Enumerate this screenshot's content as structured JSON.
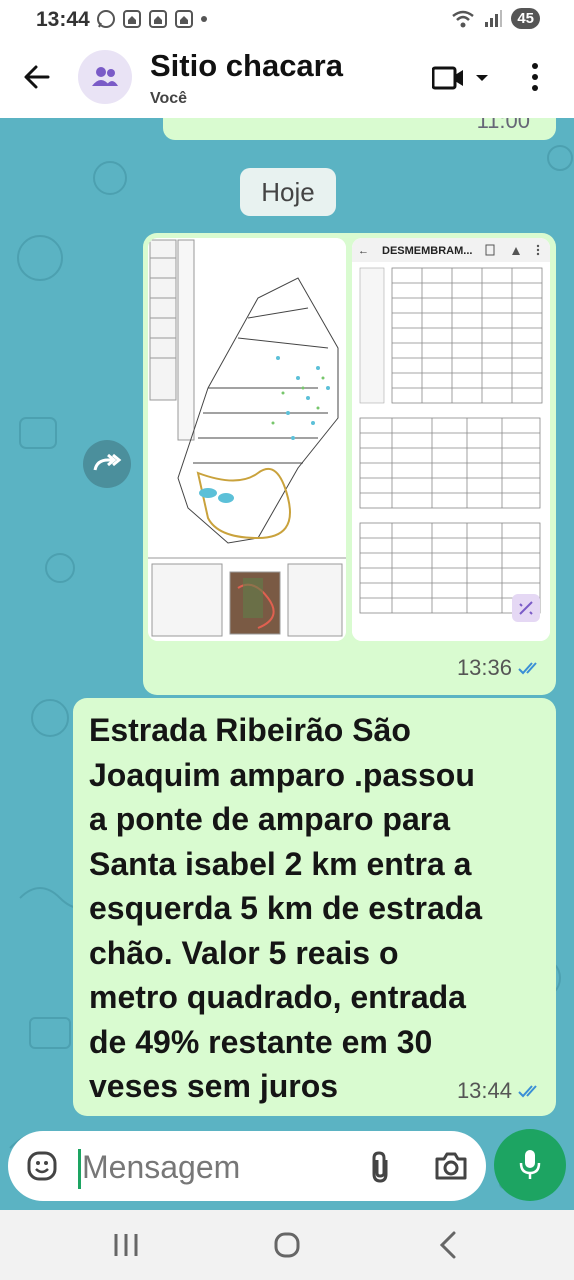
{
  "status": {
    "time": "13:44",
    "battery": "45"
  },
  "header": {
    "title": "Sitio chacara",
    "subtitle": "Você"
  },
  "chat": {
    "previous_message_time": "11:00",
    "date_divider": "Hoje",
    "image_message": {
      "thumbnail_b_title": "DESMEMBRAM...",
      "time": "13:36"
    },
    "text_message": {
      "text": "Estrada Ribeirão São\nJoaquim  amparo .passou\na ponte de  amparo para\nSanta isabel 2 km entra a\nesquerda  5 km de estrada\nchão. Valor 5 reais o\nmetro quadrado, entrada\nde 49% restante em 30\nveses sem juros",
      "time": "13:44"
    }
  },
  "composer": {
    "placeholder": "Mensagem"
  },
  "colors": {
    "chat_background": "#5bb3c3",
    "outgoing_bubble": "#d9fbd0",
    "accent_green": "#1da462",
    "read_ticks": "#3a8fd6"
  },
  "icons": [
    "whatsapp-icon",
    "home-icon",
    "wifi-icon",
    "signal-icon",
    "back-arrow-icon",
    "group-icon",
    "video-call-icon",
    "more-options-icon",
    "forward-icon",
    "double-check-icon",
    "emoji-icon",
    "attach-icon",
    "camera-icon",
    "mic-icon",
    "recents-icon",
    "home-nav-icon",
    "back-nav-icon"
  ]
}
